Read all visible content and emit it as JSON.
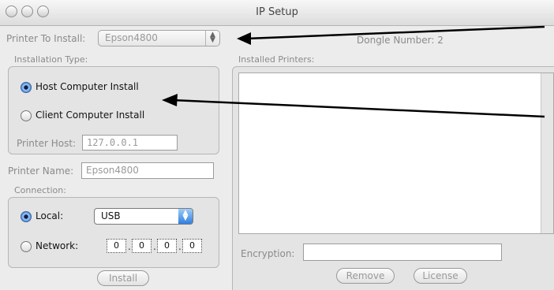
{
  "window": {
    "title": "IP Setup"
  },
  "printer_to_install": {
    "label": "Printer To Install:",
    "value": "Epson4800"
  },
  "dongle": {
    "text": "Dongle Number: 2"
  },
  "installation_type": {
    "label": "Installation Type:",
    "options": [
      {
        "label": "Host Computer Install",
        "selected": true
      },
      {
        "label": "Client Computer Install",
        "selected": false
      }
    ],
    "printer_host_label": "Printer Host:",
    "printer_host_value": "127.0.0.1"
  },
  "printer_name": {
    "label": "Printer Name:",
    "value": "Epson4800"
  },
  "connection": {
    "label": "Connection:",
    "local_label": "Local:",
    "local_selected": true,
    "local_value": "USB",
    "network_label": "Network:",
    "network_selected": false,
    "ip_octets": [
      "0",
      "0",
      "0",
      "0"
    ]
  },
  "installed_printers": {
    "label": "Installed Printers:",
    "items": []
  },
  "encryption": {
    "label": "Encryption:",
    "value": ""
  },
  "buttons": {
    "install": "Install",
    "remove": "Remove",
    "license": "License"
  },
  "colors": {
    "accent": "#3c83e0",
    "window_bg": "#ececec",
    "disabled_text": "#999999"
  }
}
